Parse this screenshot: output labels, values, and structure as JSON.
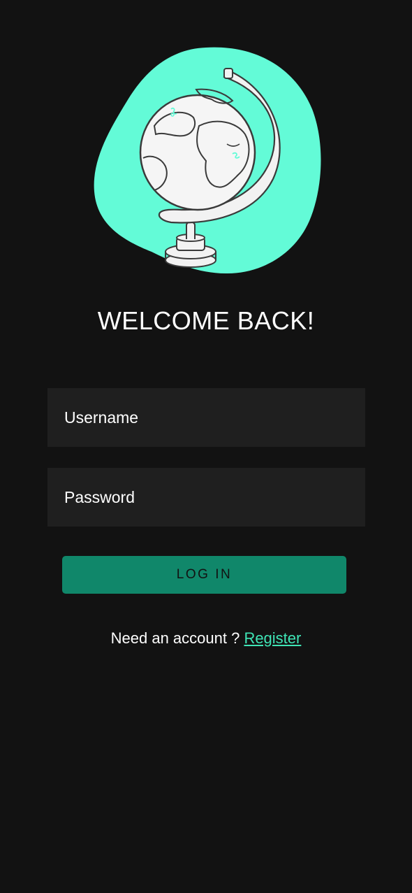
{
  "colors": {
    "background": "#121212",
    "field_background": "#1f1f1f",
    "accent": "#63fbd7",
    "button": "#10876a",
    "link": "#3fe5b6"
  },
  "hero": {
    "icon": "globe-illustration-icon"
  },
  "welcome": {
    "title": "WELCOME BACK!"
  },
  "form": {
    "username_placeholder": "Username",
    "username_value": "",
    "password_placeholder": "Password",
    "password_value": "",
    "login_label": "LOG IN"
  },
  "register": {
    "prompt": "Need an account ? ",
    "link_label": "Register"
  }
}
